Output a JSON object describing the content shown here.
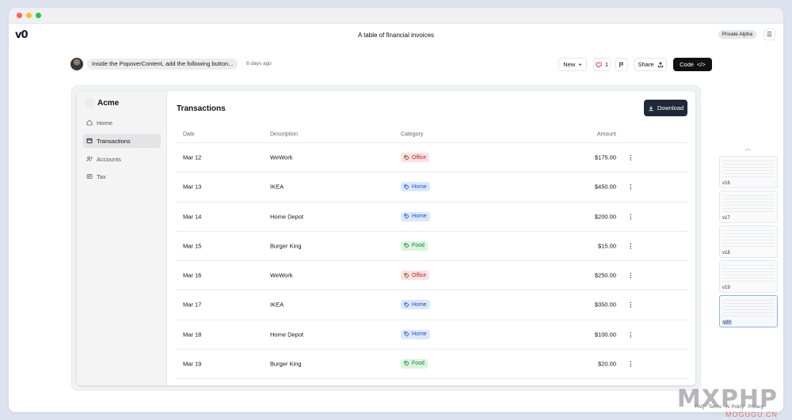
{
  "window": {
    "dot_colors": [
      "#ff5f57",
      "#febc2e",
      "#28c840"
    ]
  },
  "topbar": {
    "logo": "v0",
    "title": "A table of financial invoices",
    "badge": "Private Alpha",
    "menu_icon": "menu-icon"
  },
  "chat": {
    "prompt": "Inside the PopoverContent, add the following button...",
    "time": "8 days ago",
    "new_label": "New",
    "likes": "1",
    "share_label": "Share",
    "code_label": "Code"
  },
  "app": {
    "brand": "Acme",
    "nav": [
      {
        "label": "Home",
        "icon": "home-icon"
      },
      {
        "label": "Transactions",
        "icon": "transactions-icon"
      },
      {
        "label": "Accounts",
        "icon": "users-icon"
      },
      {
        "label": "Tax",
        "icon": "receipt-icon"
      }
    ],
    "title": "Transactions",
    "download_label": "Download",
    "columns": {
      "date": "Date",
      "description": "Description",
      "category": "Category",
      "amount": "Amount"
    },
    "rows": [
      {
        "date": "Mar 12",
        "description": "WeWork",
        "category": "Office",
        "amount": "$175.00"
      },
      {
        "date": "Mar 13",
        "description": "IKEA",
        "category": "Home",
        "amount": "$450.00"
      },
      {
        "date": "Mar 14",
        "description": "Home Depot",
        "category": "Home",
        "amount": "$200.00"
      },
      {
        "date": "Mar 15",
        "description": "Burger King",
        "category": "Food",
        "amount": "$15.00"
      },
      {
        "date": "Mar 16",
        "description": "WeWork",
        "category": "Office",
        "amount": "$250.00"
      },
      {
        "date": "Mar 17",
        "description": "IKEA",
        "category": "Home",
        "amount": "$350.00"
      },
      {
        "date": "Mar 18",
        "description": "Home Depot",
        "category": "Home",
        "amount": "$100.00"
      },
      {
        "date": "Mar 19",
        "description": "Burger King",
        "category": "Food",
        "amount": "$20.00"
      }
    ],
    "category_colors": {
      "Office": {
        "bg": "#fde2e2",
        "fg": "#b42318"
      },
      "Home": {
        "bg": "#dbe8fb",
        "fg": "#1d4ed8"
      },
      "Food": {
        "bg": "#d9f5de",
        "fg": "#15803d"
      }
    }
  },
  "versions": [
    {
      "label": "v16"
    },
    {
      "label": "v17"
    },
    {
      "label": "v18"
    },
    {
      "label": "v19"
    },
    {
      "label": "v20",
      "active": true
    }
  ],
  "footer": {
    "links": [
      "FAQ",
      "Terms",
      "AI Policy",
      "Privacy"
    ]
  },
  "watermark": {
    "big": "MXPHP",
    "small": "MOGUGU.CN"
  }
}
